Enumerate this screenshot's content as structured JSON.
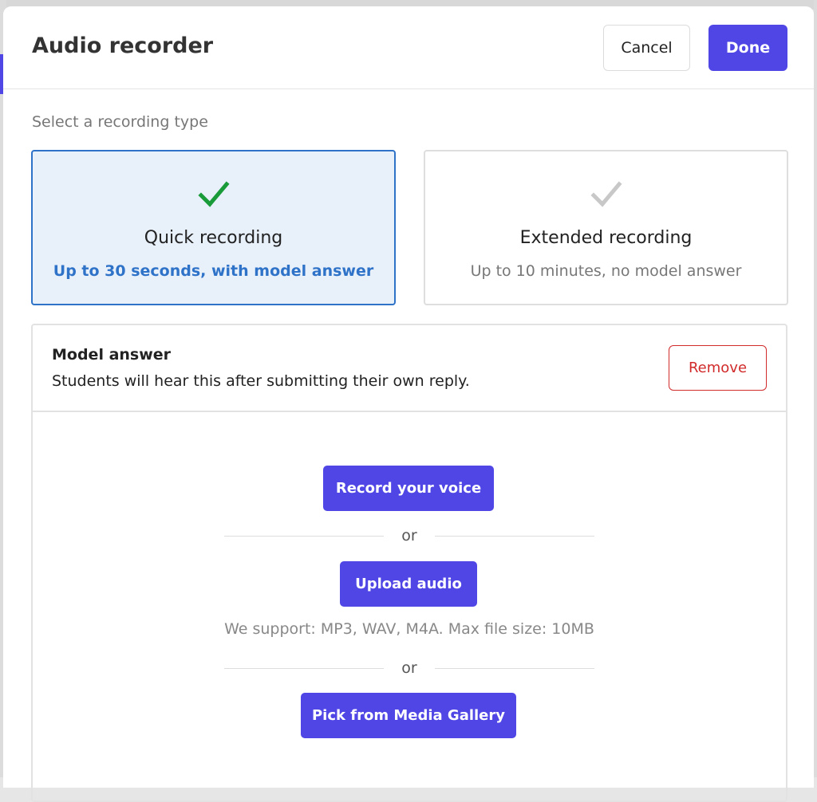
{
  "header": {
    "title": "Audio recorder",
    "cancel_label": "Cancel",
    "done_label": "Done"
  },
  "recording_type": {
    "label": "Select a recording type",
    "options": [
      {
        "title": "Quick recording",
        "subtitle": "Up to 30 seconds, with model answer",
        "selected": true,
        "icon": "check-icon"
      },
      {
        "title": "Extended recording",
        "subtitle": "Up to 10 minutes, no model answer",
        "selected": false,
        "icon": "check-icon"
      }
    ]
  },
  "model_answer": {
    "title": "Model answer",
    "description": "Students will hear this after submitting their own reply.",
    "remove_label": "Remove",
    "record_label": "Record your voice",
    "or_1": "or",
    "upload_label": "Upload audio",
    "support_text": "We support: MP3, WAV, M4A. Max file size: 10MB",
    "or_2": "or",
    "gallery_label": "Pick from Media Gallery"
  },
  "colors": {
    "accent": "#4f46e5",
    "selected_border": "#2f73c9",
    "selected_bg": "#e8f0fa",
    "check_active": "#1a9b3a",
    "check_inactive": "#c8c8c8",
    "danger": "#d12b2b"
  }
}
